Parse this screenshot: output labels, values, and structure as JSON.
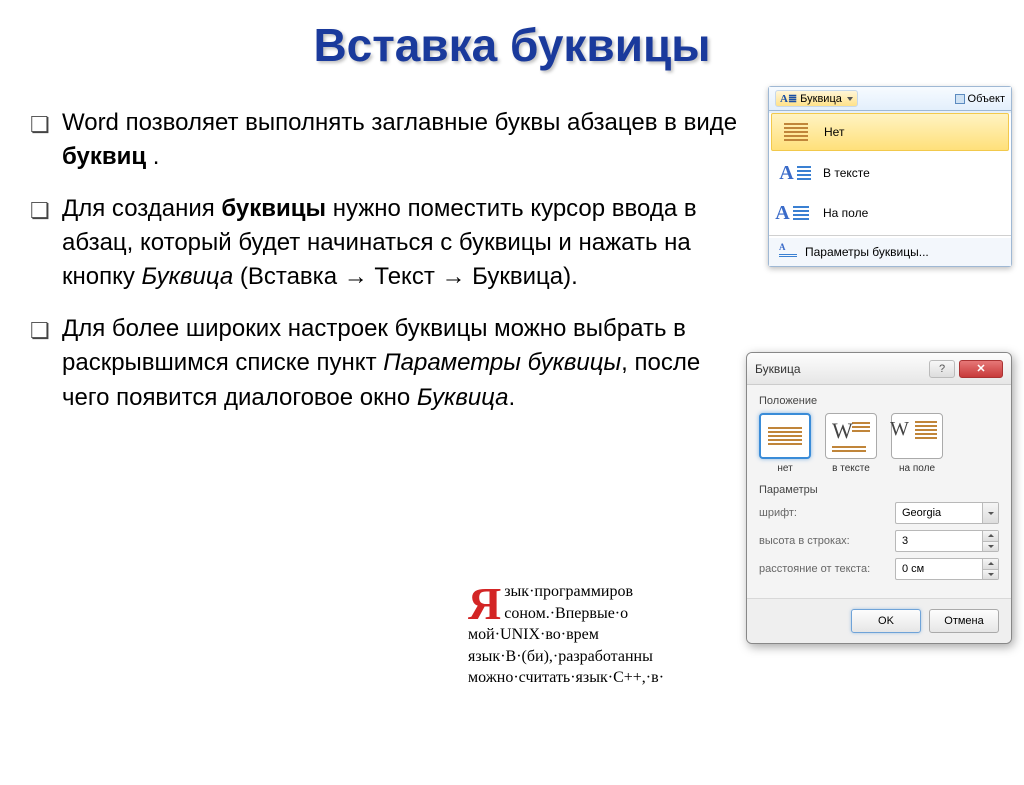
{
  "title": "Вставка буквицы",
  "paragraphs": {
    "p1_a": "Word позволяет выполнять заглавные буквы абзацев в виде ",
    "p1_b": "буквиц",
    "p1_c": " .",
    "p2_a": "Для создания ",
    "p2_b": "буквицы",
    "p2_c": " нужно поместить курсор ввода в абзац, который будет начинаться с буквицы и нажать на кнопку ",
    "p2_d": "Буквица",
    "p2_e": " (Вставка → Текст → Буквица).",
    "p3_a": "Для более широких настроек буквицы можно выбрать в раскрывшимся списке пункт ",
    "p3_b": "Параметры буквицы",
    "p3_c": ", после чего появится диалоговое окно ",
    "p3_d": "Буквица",
    "p3_e": "."
  },
  "ribbon": {
    "button_label": "Буквица",
    "object_label": "Объект",
    "items": [
      "Нет",
      "В тексте",
      "На поле"
    ],
    "footer": "Параметры буквицы..."
  },
  "dialog": {
    "title": "Буквица",
    "help": "?",
    "close": "✕",
    "section_pos": "Положение",
    "section_param": "Параметры",
    "pos": [
      "нет",
      "в тексте",
      "на поле"
    ],
    "param_font": "шрифт:",
    "param_font_val": "Georgia",
    "param_height": "высота в строках:",
    "param_height_val": "3",
    "param_dist": "расстояние от текста:",
    "param_dist_val": "0 см",
    "ok": "OK",
    "cancel": "Отмена"
  },
  "sample": {
    "dropcap": "Я",
    "line1": "зык·программиров",
    "line2": "соном.·Впервые·о",
    "line3": "мой·UNIX·во·врем",
    "line4": "язык·В·(би),·разработанны",
    "line5": "можно·считать·язык·С++,·в·"
  }
}
